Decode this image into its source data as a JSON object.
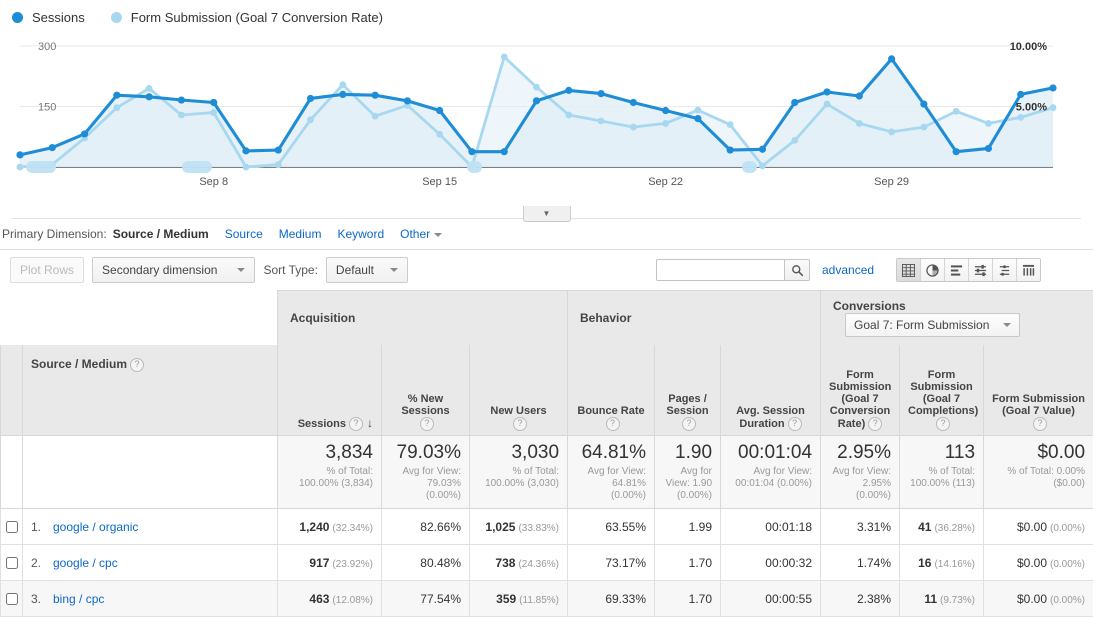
{
  "legend": [
    {
      "label": "Sessions",
      "color": "#1f8dd6",
      "icon": "legend-dot"
    },
    {
      "label": "Form Submission (Goal 7 Conversion Rate)",
      "color": "#a8d8ef",
      "icon": "legend-dot"
    }
  ],
  "chart_data": {
    "type": "line",
    "title": "",
    "xlabel": "",
    "ylabel": "Sessions",
    "y2label": "Form Submission (Goal 7 Conversion Rate)",
    "yticks": [
      "300",
      "150"
    ],
    "ylim": [
      0,
      300
    ],
    "y2ticks": [
      "10.00%",
      "5.00%"
    ],
    "y2lim": [
      0,
      10
    ],
    "xticks": [
      "Sep 8",
      "Sep 15",
      "Sep 22",
      "Sep 29"
    ],
    "xtick_index": [
      6,
      13,
      20,
      27
    ],
    "grid": true,
    "legend_position": "top-left",
    "series": [
      {
        "name": "Sessions",
        "color": "#1f8dd6",
        "axis": "left",
        "values": [
          30,
          48,
          82,
          178,
          174,
          166,
          160,
          40,
          42,
          170,
          180,
          178,
          164,
          140,
          38,
          38,
          164,
          190,
          182,
          160,
          140,
          120,
          42,
          44,
          160,
          186,
          176,
          268,
          156,
          38,
          46,
          180,
          196
        ]
      },
      {
        "name": "Form Submission (Goal 7 Conversion Rate)",
        "color": "#a8d8ef",
        "axis": "right",
        "values": [
          0.0,
          0.2,
          2.4,
          4.9,
          6.5,
          4.3,
          4.5,
          0.0,
          0.2,
          3.9,
          6.8,
          4.2,
          5.1,
          2.7,
          0.0,
          9.1,
          6.6,
          4.3,
          3.8,
          3.3,
          3.6,
          4.7,
          3.5,
          0.1,
          2.2,
          5.2,
          3.6,
          2.9,
          3.3,
          4.6,
          3.6,
          4.1,
          4.9
        ]
      }
    ]
  },
  "chart": {
    "collapse_tab_icon": "chevron-down-icon"
  },
  "primary_dimension": {
    "label": "Primary Dimension:",
    "active": "Source / Medium",
    "links": [
      "Source",
      "Medium",
      "Keyword"
    ],
    "other": "Other"
  },
  "toolbar": {
    "plot_rows": "Plot Rows",
    "secondary_dimension": "Secondary dimension",
    "sort_type_label": "Sort Type:",
    "sort_type_value": "Default",
    "search_value": "",
    "search_placeholder": "",
    "search_icon": "search-icon",
    "advanced": "advanced",
    "view_icons": [
      {
        "name": "table-view-icon",
        "active": true
      },
      {
        "name": "percentage-pie-view-icon",
        "active": false
      },
      {
        "name": "performance-bar-view-icon",
        "active": false
      },
      {
        "name": "comparison-view-icon",
        "active": false
      },
      {
        "name": "term-cloud-view-icon",
        "active": false
      },
      {
        "name": "pivot-view-icon",
        "active": false
      }
    ]
  },
  "table": {
    "groups": [
      {
        "name": "Acquisition",
        "span": 3
      },
      {
        "name": "Behavior",
        "span": 3
      },
      {
        "name": "Conversions",
        "span": 3,
        "select": "Goal 7: Form Submission"
      }
    ],
    "dimension_header": "Source / Medium",
    "columns": [
      {
        "label": "Sessions",
        "sorted": "desc"
      },
      {
        "label": "% New Sessions"
      },
      {
        "label": "New Users"
      },
      {
        "label": "Bounce Rate"
      },
      {
        "label": "Pages / Session"
      },
      {
        "label": "Avg. Session Duration"
      },
      {
        "label": "Form Submission (Goal 7 Conversion Rate)"
      },
      {
        "label": "Form Submission (Goal 7 Completions)"
      },
      {
        "label": "Form Submission (Goal 7 Value)"
      }
    ],
    "summary": [
      {
        "value": "3,834",
        "sub": "% of Total: 100.00% (3,834)"
      },
      {
        "value": "79.03%",
        "sub": "Avg for View: 79.03% (0.00%)"
      },
      {
        "value": "3,030",
        "sub": "% of Total: 100.00% (3,030)"
      },
      {
        "value": "64.81%",
        "sub": "Avg for View: 64.81% (0.00%)"
      },
      {
        "value": "1.90",
        "sub": "Avg for View: 1.90 (0.00%)"
      },
      {
        "value": "00:01:04",
        "sub": "Avg for View: 00:01:04 (0.00%)"
      },
      {
        "value": "2.95%",
        "sub": "Avg for View: 2.95% (0.00%)"
      },
      {
        "value": "113",
        "sub": "% of Total: 100.00% (113)"
      },
      {
        "value": "$0.00",
        "sub": "% of Total: 0.00% ($0.00)"
      }
    ],
    "rows": [
      {
        "index": "1.",
        "source": "google / organic",
        "sessions": "1,240",
        "sessions_pct": "(32.34%)",
        "new_sessions": "82.66%",
        "new_users": "1,025",
        "new_users_pct": "(33.83%)",
        "bounce_rate": "63.55%",
        "pages_session": "1.99",
        "avg_duration": "00:01:18",
        "goal_rate": "3.31%",
        "goal_completions": "41",
        "goal_completions_pct": "(36.28%)",
        "goal_value": "$0.00",
        "goal_value_pct": "(0.00%)"
      },
      {
        "index": "2.",
        "source": "google / cpc",
        "sessions": "917",
        "sessions_pct": "(23.92%)",
        "new_sessions": "80.48%",
        "new_users": "738",
        "new_users_pct": "(24.36%)",
        "bounce_rate": "73.17%",
        "pages_session": "1.70",
        "avg_duration": "00:00:32",
        "goal_rate": "1.74%",
        "goal_completions": "16",
        "goal_completions_pct": "(14.16%)",
        "goal_value": "$0.00",
        "goal_value_pct": "(0.00%)"
      },
      {
        "index": "3.",
        "source": "bing / cpc",
        "sessions": "463",
        "sessions_pct": "(12.08%)",
        "new_sessions": "77.54%",
        "new_users": "359",
        "new_users_pct": "(11.85%)",
        "bounce_rate": "69.33%",
        "pages_session": "1.70",
        "avg_duration": "00:00:55",
        "goal_rate": "2.38%",
        "goal_completions": "11",
        "goal_completions_pct": "(9.73%)",
        "goal_value": "$0.00",
        "goal_value_pct": "(0.00%)"
      }
    ]
  }
}
